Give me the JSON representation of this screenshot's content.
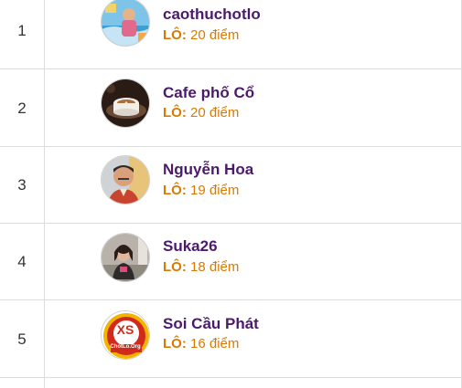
{
  "leaderboard": {
    "score_label": "LÔ:",
    "rows": [
      {
        "rank": "1",
        "name": "caothuchotlo",
        "score": "20 điểm",
        "avatar": "beach-photo-avatar"
      },
      {
        "rank": "2",
        "name": "Cafe phố Cổ",
        "score": "20 điểm",
        "avatar": "coffee-cup-avatar"
      },
      {
        "rank": "3",
        "name": "Nguyễn Hoa",
        "score": "19 điểm",
        "avatar": "man-portrait-avatar"
      },
      {
        "rank": "4",
        "name": "Suka26",
        "score": "18 điểm",
        "avatar": "woman-outdoor-avatar"
      },
      {
        "rank": "5",
        "name": "Soi Cầu Phát",
        "score": "16 điểm",
        "avatar": "xs-logo-avatar"
      }
    ]
  },
  "logo": {
    "xs_text": "XS",
    "xs_site": "ChotLo.Org"
  },
  "colors": {
    "name": "#4b1b6b",
    "score": "#d97a00",
    "border": "#dcdcdc"
  }
}
